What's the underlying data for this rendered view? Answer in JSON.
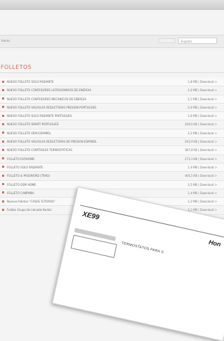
{
  "header": {
    "top_links": "",
    "breadcrumb": "Inicio",
    "search_placeholder": "",
    "language_select": "Español"
  },
  "main": {
    "section_title": "FOLLETOS",
    "files": [
      {
        "name": "NUEVO FOLLETO SOLO RADIANTE",
        "meta": "1,8 MB | Download >"
      },
      {
        "name": "NUEVO FOLLETO CONTADORES ULTRASONIDOS DE ENERGIA",
        "meta": "2,0 MB | Download >"
      },
      {
        "name": "NUEVO FOLLETO CONTADORES MECANICOS DE ENERGIA",
        "meta": "2,1 MB | Download >"
      },
      {
        "name": "NUEVO FOLLETO VALVULAS REDUCTORAS PRESION PORTUGUES",
        "meta": "2,4 MB | Download >"
      },
      {
        "name": "NUEVO FOLLETO SOLO RADIANTE PORTUGUES",
        "meta": "1,6 MB | Download >"
      },
      {
        "name": "NUEVO FOLLETO SMART PORTUGUES",
        "meta": "200,6 KB | Download >"
      },
      {
        "name": "NUEVO FOLLETO OEM ESPAÑOL",
        "meta": "3,2 MB | Download >"
      },
      {
        "name": "NUEVO FOLLETO VALVULAS REDUCTORAS DE PRESION ESPAÑOL",
        "meta": "203,9 KB | Download >"
      },
      {
        "name": "NUEVO FOLLETO CONTROLES TERMOSTATICAS",
        "meta": "387,8 KB | Download >"
      },
      {
        "name": "FOLLETO EVOHOME",
        "meta": "273,3 KB | Download >"
      },
      {
        "name": "FOLLETO SOLO RADIANTE",
        "meta": "1,4 MB | Download >"
      },
      {
        "name": "FOLLETO & PASSWORD (TRAD)",
        "meta": "460,5 KB | Download >"
      },
      {
        "name": "FOLLETO OEM HOME",
        "meta": "3,5 MB | Download >"
      },
      {
        "name": "FOLLETO CAMPAÑA",
        "meta": "1,4 MB | Download >"
      },
      {
        "name": "Nuevos folletos \"CASAS FUTUROS\"",
        "meta": "1,2 MB | Download >"
      },
      {
        "name": "Folleto Grupo de Llenado Kombi",
        "meta": "1,1 MB | Download >"
      }
    ]
  },
  "document_preview": {
    "model": "XE99",
    "brand": "Hon",
    "title": "TERMOSTATOS PARA S"
  }
}
